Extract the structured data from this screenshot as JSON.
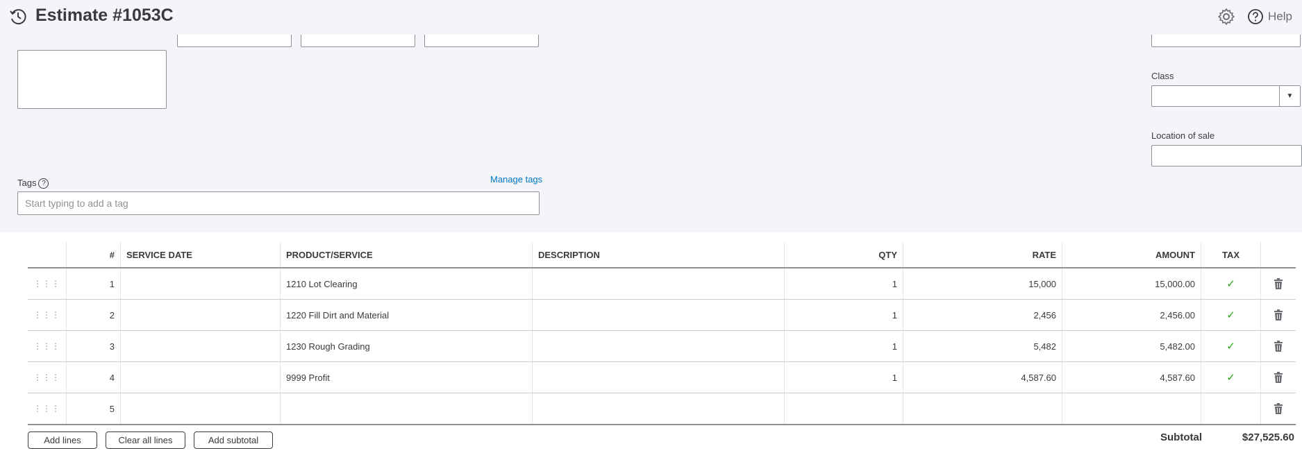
{
  "header": {
    "title": "Estimate #1053C",
    "help_label": "Help",
    "icons": [
      "history-icon",
      "gear-icon",
      "help-circle-icon"
    ]
  },
  "form": {
    "class_label": "Class",
    "class_value": "",
    "location_label": "Location of sale",
    "location_value": "",
    "tags_label": "Tags",
    "tags_placeholder": "Start typing to add a tag",
    "manage_tags_label": "Manage tags"
  },
  "table": {
    "headers": [
      "",
      "#",
      "SERVICE DATE",
      "PRODUCT/SERVICE",
      "DESCRIPTION",
      "QTY",
      "RATE",
      "AMOUNT",
      "TAX",
      ""
    ],
    "rows": [
      {
        "num": "1",
        "service_date": "",
        "product": "1210 Lot Clearing",
        "description": "",
        "qty": "1",
        "rate": "15,000",
        "amount": "15,000.00",
        "tax": "✓"
      },
      {
        "num": "2",
        "service_date": "",
        "product": "1220 Fill Dirt and Material",
        "description": "",
        "qty": "1",
        "rate": "2,456",
        "amount": "2,456.00",
        "tax": "✓"
      },
      {
        "num": "3",
        "service_date": "",
        "product": "1230 Rough Grading",
        "description": "",
        "qty": "1",
        "rate": "5,482",
        "amount": "5,482.00",
        "tax": "✓"
      },
      {
        "num": "4",
        "service_date": "",
        "product": "9999 Profit",
        "description": "",
        "qty": "1",
        "rate": "4,587.60",
        "amount": "4,587.60",
        "tax": "✓"
      },
      {
        "num": "5",
        "service_date": "",
        "product": "",
        "description": "",
        "qty": "",
        "rate": "",
        "amount": "",
        "tax": ""
      }
    ]
  },
  "footer": {
    "add_lines": "Add lines",
    "clear_all_lines": "Clear all lines",
    "add_subtotal": "Add subtotal",
    "subtotal_label": "Subtotal",
    "subtotal_value": "$27,525.60"
  },
  "colors": {
    "accent_link": "#0077c5",
    "tax_check": "#2ca01c",
    "panel_bg": "#f4f5f8"
  }
}
